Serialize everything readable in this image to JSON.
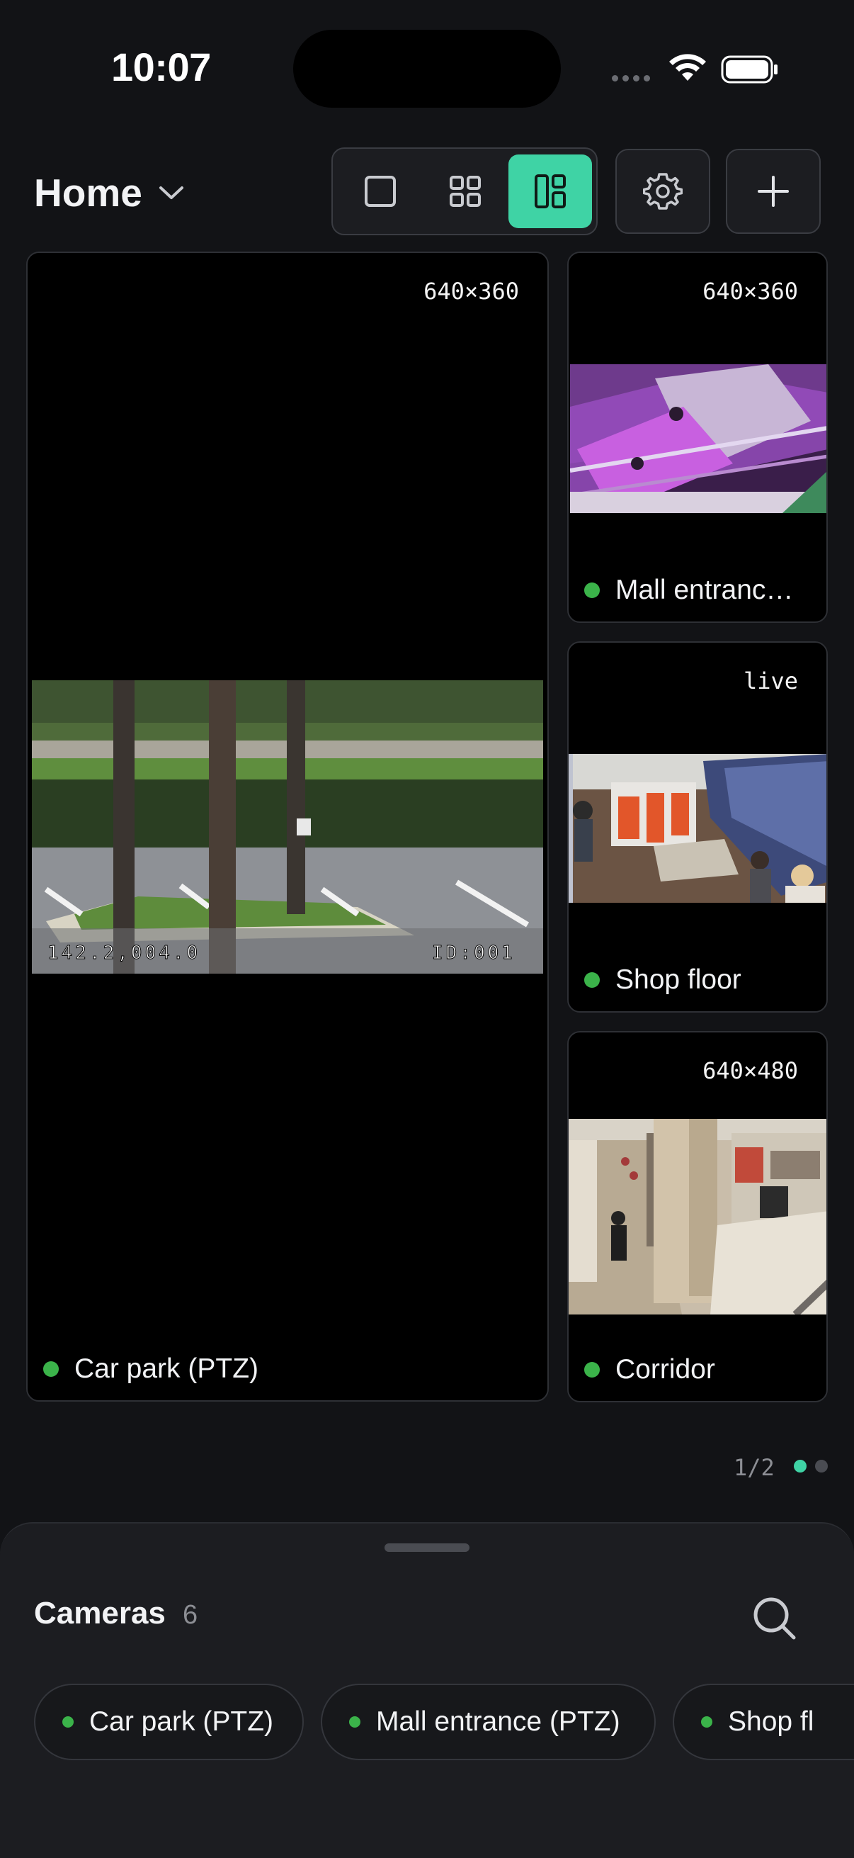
{
  "status_bar": {
    "time": "10:07"
  },
  "header": {
    "title": "Home",
    "layout_modes": [
      "single",
      "grid-2x2",
      "grid-1-plus-3"
    ],
    "active_layout": "grid-1-plus-3",
    "accent": "#3FD3A5"
  },
  "tiles": [
    {
      "name": "Car park (PTZ)",
      "resolution": "640×360",
      "status": "online",
      "osd_left": "142.2,004.0",
      "osd_right": "ID:001"
    },
    {
      "name": "Mall entranc…",
      "resolution": "640×360",
      "status": "online"
    },
    {
      "name": "Shop floor",
      "resolution": "live",
      "status": "online"
    },
    {
      "name": "Corridor",
      "resolution": "640×480",
      "status": "online"
    }
  ],
  "pager": {
    "text": "1/2",
    "pages": 2,
    "current": 1
  },
  "sheet": {
    "title": "Cameras",
    "count": "6",
    "chips": [
      "Car park (PTZ)",
      "Mall entrance (PTZ)",
      "Shop fl"
    ]
  },
  "colors": {
    "online": "#3BB34A",
    "background": "#121316",
    "tile": "#000000"
  }
}
